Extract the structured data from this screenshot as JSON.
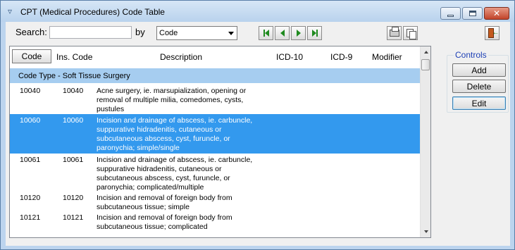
{
  "window": {
    "title": "CPT (Medical Procedures) Code Table"
  },
  "toolbar": {
    "search_label": "Search:",
    "search_value": "",
    "by_label": "by",
    "by_selected": "Code"
  },
  "grid": {
    "columns": {
      "code": "Code",
      "ins_code": "Ins. Code",
      "description": "Description",
      "icd10": "ICD-10",
      "icd9": "ICD-9",
      "modifier": "Modifier"
    },
    "group_label": "Code Type - Soft Tissue Surgery",
    "rows": [
      {
        "code": "10040",
        "ins_code": "10040",
        "description": "Acne surgery, ie. marsupialization, opening or removal of multiple milia, comedomes, cysts, pustules",
        "selected": false
      },
      {
        "code": "10060",
        "ins_code": "10060",
        "description": "Incision and drainage of abscess, ie. carbuncle, suppurative hidradenitis, cutaneous or subcutaneous abscess, cyst, furuncle, or paronychia; simple/single",
        "selected": true
      },
      {
        "code": "10061",
        "ins_code": "10061",
        "description": "Incision and drainage of abscess, ie. carbuncle, suppurative hidradenitis, cutaneous or subcutaneous abscess, cyst, furuncle, or paronychia; complicated/multiple",
        "selected": false
      },
      {
        "code": "10120",
        "ins_code": "10120",
        "description": "Incision and removal of foreign body from subcutaneous tissue; simple",
        "selected": false
      },
      {
        "code": "10121",
        "ins_code": "10121",
        "description": "Incision and removal of foreign body from subcutaneous tissue; complicated",
        "selected": false
      }
    ]
  },
  "controls": {
    "legend": "Controls",
    "add_label": "Add",
    "delete_label": "Delete",
    "edit_label": "Edit"
  },
  "colors": {
    "selection": "#3399ee",
    "group_row": "#a6cdf0",
    "controls_legend": "#1c3fb5"
  }
}
